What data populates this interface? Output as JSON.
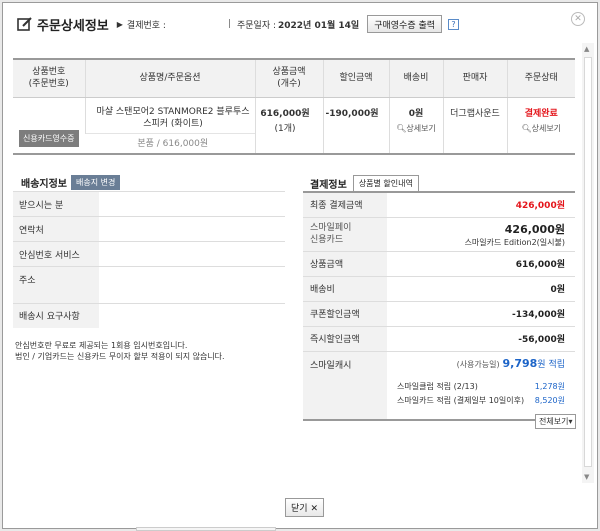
{
  "header": {
    "title": "주문상세정보",
    "payment_no_label": "결제번호 :",
    "order_date_label": "주문일자 :",
    "order_date_value": "2022년 01월 14일",
    "receipt_button": "구매영수증 출력",
    "help_icon": "?"
  },
  "product_table": {
    "headers": [
      "상품번호\n(주문번호)",
      "상품명/주문옵션",
      "상품금액\n(개수)",
      "할인금액",
      "배송비",
      "판매자",
      "주문상태"
    ],
    "row": {
      "card_receipt_button": "신용카드영수증",
      "product_name": "마샬 스탠모어2 STANMORE2 블루투스 스피커 (화이트)",
      "option": "본품 / 616,000원",
      "price": "616,000원",
      "quantity": "(1개)",
      "discount": "-190,000원",
      "shipping": "0원",
      "shipping_detail": "상세보기",
      "seller": "더그랩사운드",
      "status": "결제완료",
      "status_detail": "상세보기"
    }
  },
  "shipping_info": {
    "title": "배송지정보",
    "change_button": "배송지 변경",
    "fields": [
      "받으시는 분",
      "연락처",
      "안심번호 서비스",
      "주소",
      "배송시 요구사항"
    ],
    "notice_line1": "안심번호란 무료로 제공되는 1회용 임시번호입니다.",
    "notice_line2": "법인 / 기업카드는 신용카드 무이자 할부 적용이 되지 않습니다."
  },
  "payment_info": {
    "title": "결제정보",
    "detail_button": "상품별 할인내역",
    "final_label": "최종 결제금액",
    "final_value": "426,000원",
    "method_label1": "스마일페이",
    "method_label2": "신용카드",
    "method_value": "426,000원",
    "method_sub": "스마일카드 Edition2(일시불)",
    "product_amount_label": "상품금액",
    "product_amount_value": "616,000원",
    "shipping_label": "배송비",
    "shipping_value": "0원",
    "coupon_label": "쿠폰할인금액",
    "coupon_value": "-134,000원",
    "instant_label": "즉시할인금액",
    "instant_value": "-56,000원",
    "smilecash_label": "스마일캐시",
    "smilecash_available": "(사용가능일)",
    "smilecash_value": "9,798",
    "smilecash_unit": "원 적립",
    "club_label": "스마일클럽 적립 (2/13)",
    "club_value": "1,278원",
    "card_label": "스마일카드 적립 (결제일부 10일이후)",
    "card_value": "8,520원",
    "more_button": "전체보기"
  },
  "footer": {
    "close_button": "닫기"
  }
}
